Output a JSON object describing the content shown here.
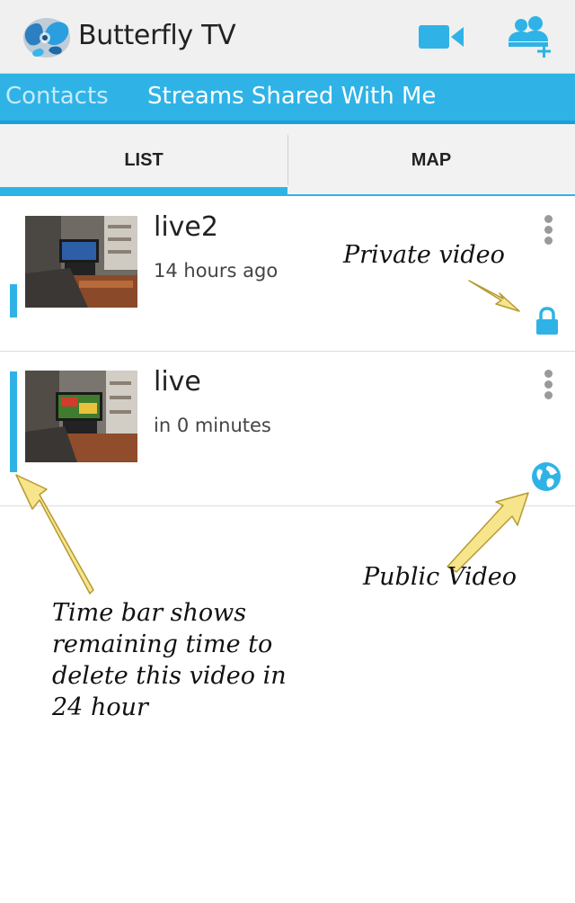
{
  "app": {
    "title": "Butterfly TV",
    "icons": {
      "logo": "butterfly-logo",
      "camera": "video-camera-icon",
      "add_contacts": "add-contacts-icon"
    },
    "colors": {
      "accent": "#2fb3e6",
      "action_bar": "#f0f0f0"
    }
  },
  "subtabs": {
    "contacts": "Contacts",
    "shared": "Streams Shared With Me"
  },
  "tabs": {
    "list": "LIST",
    "map": "MAP"
  },
  "videos": [
    {
      "title": "live2",
      "time": "14 hours ago",
      "visibility": "private",
      "visibility_icon": "lock-icon",
      "remaining_fraction": 0.3
    },
    {
      "title": "live",
      "time": "in 0 minutes",
      "visibility": "public",
      "visibility_icon": "globe-icon",
      "remaining_fraction": 0.9
    }
  ],
  "annotations": {
    "private": "Private video",
    "public": "Public Video",
    "timebar_lines": [
      "Time bar shows",
      "remaining time to",
      "delete this video in",
      "24 hour"
    ]
  }
}
